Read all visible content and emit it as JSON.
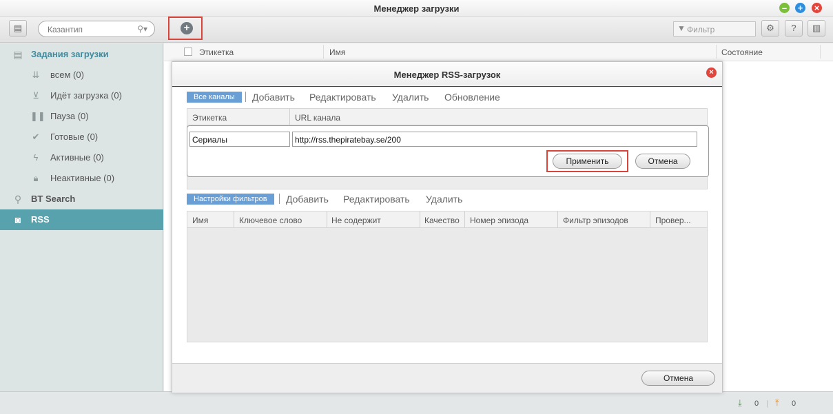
{
  "window": {
    "title": "Менеджер загрузки"
  },
  "toolbar": {
    "search_placeholder": "Казантип",
    "filter_placeholder": "Фильтр"
  },
  "sidebar": {
    "header": "Задания загрузки",
    "items": [
      {
        "label": "всем (0)",
        "icon": "arrow-down-icon"
      },
      {
        "label": "Идёт загрузка (0)",
        "icon": "download-box-icon"
      },
      {
        "label": "Пауза (0)",
        "icon": "pause-icon"
      },
      {
        "label": "Готовые (0)",
        "icon": "check-icon"
      },
      {
        "label": "Активные (0)",
        "icon": "lightning-icon"
      },
      {
        "label": "Неактивные (0)",
        "icon": "lock-icon"
      }
    ],
    "bt_search": "BT Search",
    "rss": "RSS"
  },
  "list": {
    "columns": [
      "Этикетка",
      "Имя",
      "Состояние"
    ]
  },
  "dialog": {
    "title": "Менеджер RSS-загрузок",
    "channels_toolbar": {
      "active_tab": "Все каналы",
      "links": [
        "Добавить",
        "Редактировать",
        "Удалить",
        "Обновление"
      ]
    },
    "channels_columns": [
      "Этикетка",
      "URL канала"
    ],
    "editor": {
      "label_value": "Сериалы",
      "url_value": "http://rss.thepiratebay.se/200",
      "apply": "Применить",
      "cancel": "Отмена"
    },
    "filters_toolbar": {
      "active_tab": "Настройки фильтров",
      "links": [
        "Добавить",
        "Редактировать",
        "Удалить"
      ]
    },
    "filter_columns": [
      "Имя",
      "Ключевое слово",
      "Не содержит",
      "Качество",
      "Номер эпизода",
      "Фильтр эпизодов",
      "Провер..."
    ],
    "footer_cancel": "Отмена"
  },
  "status": {
    "download_count": "0",
    "upload_count": "0"
  },
  "colors": {
    "accent": "#58a2ae",
    "tab_active": "#6a9fd6",
    "highlight": "#d9443a"
  }
}
